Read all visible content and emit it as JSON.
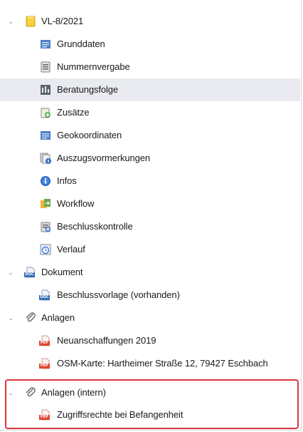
{
  "tree": {
    "root": {
      "label": "VL-8/2021",
      "icon": "folder-icon",
      "expanded": true
    },
    "root_children": [
      {
        "label": "Grunddaten",
        "icon": "form-icon"
      },
      {
        "label": "Nummernvergabe",
        "icon": "numbers-icon"
      },
      {
        "label": "Beratungsfolge",
        "icon": "council-icon",
        "selected": true
      },
      {
        "label": "Zusätze",
        "icon": "addon-icon"
      },
      {
        "label": "Geokoordinaten",
        "icon": "geo-icon"
      },
      {
        "label": "Auszugsvormerkungen",
        "icon": "excerpt-icon"
      },
      {
        "label": "Infos",
        "icon": "info-icon"
      },
      {
        "label": "Workflow",
        "icon": "workflow-icon"
      },
      {
        "label": "Beschlusskontrolle",
        "icon": "control-icon"
      },
      {
        "label": "Verlauf",
        "icon": "history-icon"
      }
    ],
    "groups": [
      {
        "label": "Dokument",
        "icon": "doc-file-icon",
        "expanded": true,
        "items": [
          {
            "label": "Beschlussvorlage (vorhanden)",
            "icon": "doc-file-icon"
          }
        ]
      },
      {
        "label": "Anlagen",
        "icon": "paperclip-icon",
        "expanded": true,
        "items": [
          {
            "label": "Neuanschaffungen 2019",
            "icon": "pdf-file-icon"
          },
          {
            "label": "OSM-Karte: Hartheimer Straße 12, 79427 Eschbach",
            "icon": "pdf-file-icon"
          }
        ]
      },
      {
        "label": "Anlagen (intern)",
        "icon": "paperclip-icon",
        "expanded": true,
        "highlighted": true,
        "items": [
          {
            "label": "Zugriffsrechte bei Befangenheit",
            "icon": "pdf-file-icon"
          }
        ]
      }
    ]
  },
  "glyphs": {
    "expanded_chevron": "⌄",
    "pdf_tag": "PDF",
    "doc_tag": "DOC"
  },
  "colors": {
    "selection": "#e9ebf0",
    "highlight_border": "#d9363e",
    "pdf": "#e0462f",
    "doc": "#3b6fb6",
    "folder": "#f5c518"
  }
}
